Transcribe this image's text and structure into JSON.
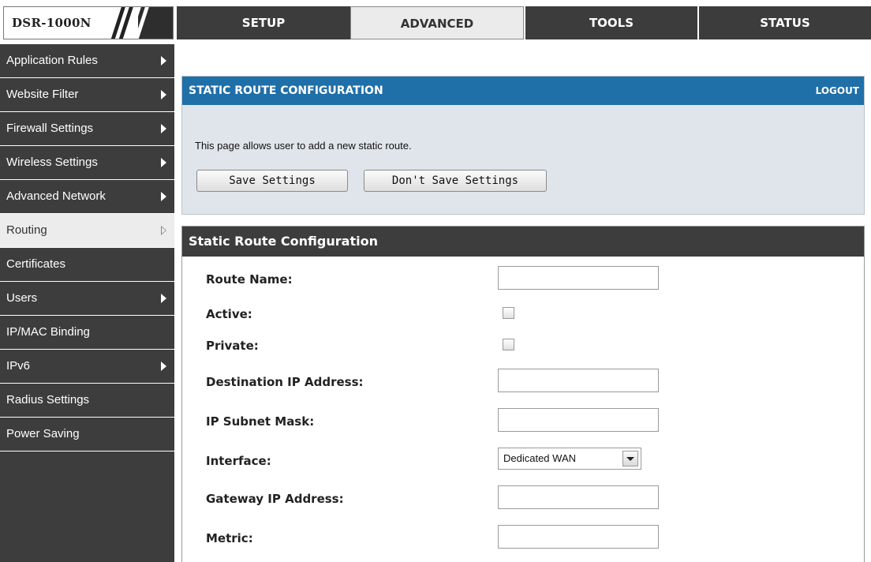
{
  "app": {
    "logo_text": "DSR-1000N"
  },
  "nav": {
    "tabs": [
      {
        "label": "SETUP"
      },
      {
        "label": "ADVANCED"
      },
      {
        "label": "TOOLS"
      },
      {
        "label": "STATUS"
      }
    ],
    "active_tab": "ADVANCED"
  },
  "sidebar": {
    "items": [
      {
        "label": "Application Rules"
      },
      {
        "label": "Website Filter"
      },
      {
        "label": "Firewall Settings"
      },
      {
        "label": "Wireless Settings"
      },
      {
        "label": "Advanced Network"
      },
      {
        "label": "Routing"
      },
      {
        "label": "Certificates"
      },
      {
        "label": "Users"
      },
      {
        "label": "IP/MAC Binding"
      },
      {
        "label": "IPv6"
      },
      {
        "label": "Radius Settings"
      },
      {
        "label": "Power Saving"
      }
    ],
    "active_item": "Routing"
  },
  "info_panel": {
    "title": "STATIC ROUTE CONFIGURATION",
    "logout_label": "LOGOUT",
    "description": "This page allows user to add a new static route.",
    "save_label": "Save Settings",
    "dont_save_label": "Don't Save Settings"
  },
  "config_panel": {
    "title": "Static Route Configuration",
    "fields": {
      "route_name": {
        "label": "Route Name:",
        "value": ""
      },
      "active": {
        "label": "Active:",
        "checked": false
      },
      "private": {
        "label": "Private:",
        "checked": false
      },
      "destination_ip": {
        "label": "Destination IP Address:",
        "value": ""
      },
      "subnet_mask": {
        "label": "IP Subnet Mask:",
        "value": ""
      },
      "interface": {
        "label": "Interface:",
        "selected": "Dedicated WAN"
      },
      "gateway_ip": {
        "label": "Gateway IP Address:",
        "value": ""
      },
      "metric": {
        "label": "Metric:",
        "value": ""
      }
    }
  },
  "colors": {
    "header_blue": "#1f6fa8",
    "dark_gray": "#3d3d3d",
    "panel_bg": "#dfe5ea"
  }
}
